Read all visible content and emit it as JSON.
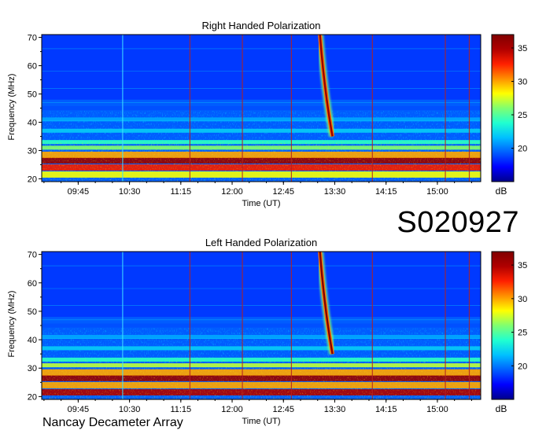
{
  "session_id": "S020927",
  "instrument": "Nancay Decameter Array",
  "colorbar": {
    "unit": "dB",
    "min": 15,
    "max": 37,
    "ticks": [
      "20",
      "25",
      "30",
      "35"
    ],
    "tick_values": [
      20,
      25,
      30,
      35
    ],
    "colors": [
      "#00008b",
      "#0000ff",
      "#0060ff",
      "#00c0ff",
      "#20ffd0",
      "#80ff70",
      "#ffff00",
      "#ff9000",
      "#ff2000",
      "#b00000",
      "#800000"
    ]
  },
  "chart_data": [
    {
      "type": "heatmap",
      "title": "Right Handed Polarization",
      "xlabel": "Time (UT)",
      "ylabel": "Frequency (MHz)",
      "x_ticks": [
        "09:45",
        "10:30",
        "11:15",
        "12:00",
        "12:45",
        "13:30",
        "14:15",
        "15:00"
      ],
      "x_tick_minutes": [
        585,
        630,
        675,
        720,
        765,
        810,
        855,
        900
      ],
      "xlim_minutes": [
        553,
        938
      ],
      "y_ticks": [
        "20",
        "30",
        "40",
        "50",
        "60",
        "70"
      ],
      "y_tick_values": [
        20,
        30,
        40,
        50,
        60,
        70
      ],
      "ylim": [
        19,
        71
      ],
      "vertical_markers_minutes": [
        624,
        683,
        729,
        772,
        843,
        907,
        928
      ],
      "burst": {
        "start_time_minutes": 797,
        "start_freq_mhz": 71,
        "end_time_minutes": 808,
        "end_freq_mhz": 35,
        "peak_db": 36
      },
      "bands": [
        {
          "freq_mhz": 21.5,
          "level_db": 28
        },
        {
          "freq_mhz": 24,
          "level_db": 33
        },
        {
          "freq_mhz": 26.5,
          "level_db": 36
        },
        {
          "freq_mhz": 28.5,
          "level_db": 30
        },
        {
          "freq_mhz": 31,
          "level_db": 26
        },
        {
          "freq_mhz": 33,
          "level_db": 24
        },
        {
          "freq_mhz": 37,
          "level_db": 22
        },
        {
          "freq_mhz": 41,
          "level_db": 21
        },
        {
          "freq_mhz": 45,
          "level_db": 19
        }
      ]
    },
    {
      "type": "heatmap",
      "title": "Left Handed Polarization",
      "xlabel": "Time (UT)",
      "ylabel": "Frequency (MHz)",
      "x_ticks": [
        "09:45",
        "10:30",
        "11:15",
        "12:00",
        "12:45",
        "13:30",
        "14:15",
        "15:00"
      ],
      "x_tick_minutes": [
        585,
        630,
        675,
        720,
        765,
        810,
        855,
        900
      ],
      "xlim_minutes": [
        553,
        938
      ],
      "y_ticks": [
        "20",
        "30",
        "40",
        "50",
        "60",
        "70"
      ],
      "y_tick_values": [
        20,
        30,
        40,
        50,
        60,
        70
      ],
      "ylim": [
        19,
        71
      ],
      "vertical_markers_minutes": [
        624,
        683,
        729,
        772,
        843,
        907,
        928
      ],
      "burst": {
        "start_time_minutes": 797,
        "start_freq_mhz": 71,
        "end_time_minutes": 808,
        "end_freq_mhz": 35,
        "peak_db": 37
      },
      "bands": [
        {
          "freq_mhz": 21.5,
          "level_db": 35
        },
        {
          "freq_mhz": 24,
          "level_db": 30
        },
        {
          "freq_mhz": 26.5,
          "level_db": 36
        },
        {
          "freq_mhz": 28.5,
          "level_db": 30
        },
        {
          "freq_mhz": 31,
          "level_db": 27
        },
        {
          "freq_mhz": 33,
          "level_db": 24
        },
        {
          "freq_mhz": 37,
          "level_db": 22
        },
        {
          "freq_mhz": 41,
          "level_db": 21
        },
        {
          "freq_mhz": 45,
          "level_db": 19
        }
      ]
    }
  ]
}
